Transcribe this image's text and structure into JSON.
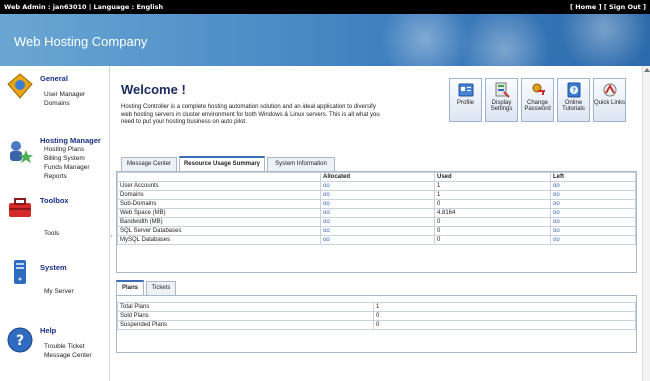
{
  "topbar": {
    "left": "Web Admin : jan63010 | Language : English",
    "right": "[ Home ] [ Sign Out ]"
  },
  "banner": {
    "title": "Web Hosting Company"
  },
  "sidebar": {
    "general": {
      "heading": "General",
      "items": [
        "User Manager",
        "Domains"
      ]
    },
    "hosting": {
      "heading": "Hosting Manager",
      "items": [
        "Hosting Plans",
        "Billing System",
        "Funds Manager",
        "Reports"
      ]
    },
    "toolbox": {
      "heading": "Toolbox",
      "items": [
        "Tools"
      ]
    },
    "system": {
      "heading": "System",
      "items": [
        "My Server"
      ]
    },
    "help": {
      "heading": "Help",
      "items": [
        "Trouble Ticket",
        "Message Center"
      ]
    }
  },
  "main": {
    "welcome": "Welcome !",
    "intro": "Hosting Controller is a complete hosting automation solution and an ideal application to diversify web hosting servers in cluster environment for both Windows & Linux servers. This is all what you need to put your hosting business on auto pilot.",
    "quick": [
      {
        "label": "Profile",
        "icon": "profile-icon"
      },
      {
        "label": "Display Settings",
        "icon": "display-settings-icon"
      },
      {
        "label": "Change Password",
        "icon": "change-password-icon"
      },
      {
        "label": "Online Tutorials",
        "icon": "online-tutorials-icon"
      },
      {
        "label": "Quick Links",
        "icon": "quick-links-icon"
      }
    ],
    "tabs": [
      "Message Center",
      "Resource Usage Summary",
      "System Information"
    ],
    "resource_table": {
      "headers": [
        "",
        "Allocated",
        "Used",
        "Left"
      ],
      "rows": [
        [
          "User Accounts",
          "oo",
          "1",
          "oo"
        ],
        [
          "Domains",
          "oo",
          "1",
          "oo"
        ],
        [
          "Sub-Domains",
          "oo",
          "0",
          "oo"
        ],
        [
          "Web Space (MB)",
          "oo",
          "4.8164",
          "oo"
        ],
        [
          "Bandwidth (MB)",
          "oo",
          "0",
          "oo"
        ],
        [
          "SQL Server Databases",
          "oo",
          "0",
          "oo"
        ],
        [
          "MySQL Databases",
          "oo",
          "0",
          "oo"
        ]
      ]
    },
    "tabs2": [
      "Plans",
      "Tickets"
    ],
    "plans_table": {
      "rows": [
        [
          "Total Plans",
          "1"
        ],
        [
          "Sold Plans",
          "0"
        ],
        [
          "Suspended Plans",
          "0"
        ]
      ]
    }
  }
}
